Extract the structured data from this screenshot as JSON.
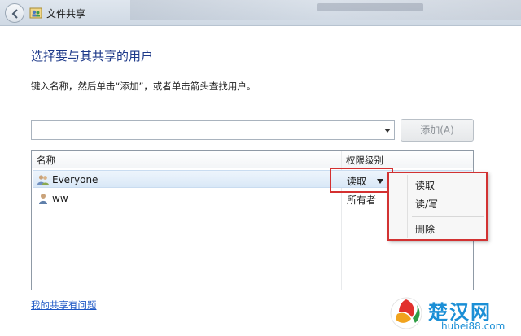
{
  "window": {
    "title": "文件共享"
  },
  "heading": "选择要与其共享的用户",
  "instruction": "键入名称，然后单击“添加”，或者单击箭头查找用户。",
  "user_input": {
    "value": "",
    "placeholder": ""
  },
  "add_button": {
    "label": "添加(A)",
    "enabled": false
  },
  "list": {
    "columns": [
      "名称",
      "权限级别"
    ],
    "rows": [
      {
        "name": "Everyone",
        "permission": "读取",
        "icon": "group-user-icon",
        "selected": true
      },
      {
        "name": "ww",
        "permission": "所有者",
        "icon": "single-user-icon",
        "selected": false
      }
    ]
  },
  "permission_menu": {
    "items": [
      {
        "label": "读取",
        "checked": true
      },
      {
        "label": "读/写",
        "checked": false
      },
      {
        "label": "删除",
        "checked": false
      }
    ]
  },
  "help_link": "我的共享有问题",
  "watermark": {
    "name": "楚汉网",
    "url": "hubei88.com"
  },
  "colors": {
    "heading": "#1e3a8a",
    "link": "#1a55c4",
    "highlight_border": "#d43030",
    "watermark": "#1b8fd6"
  }
}
